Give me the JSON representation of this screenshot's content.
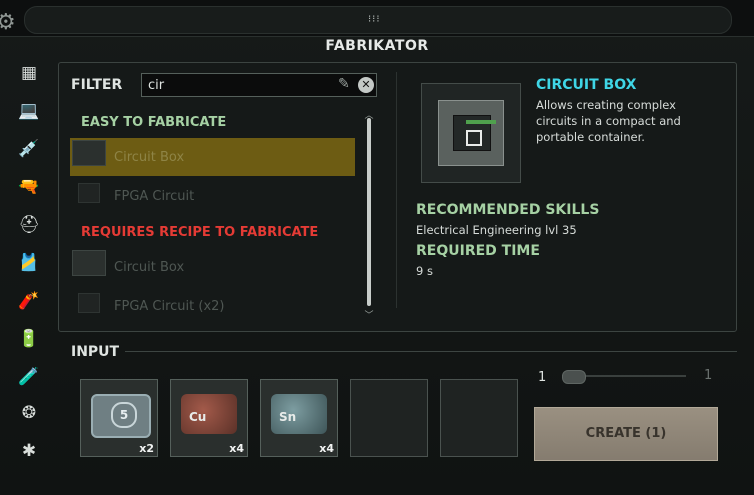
{
  "window": {
    "title": "FABRIKATOR"
  },
  "sidebar": {
    "items": [
      {
        "name": "all-categories-icon",
        "glyph": "▦"
      },
      {
        "name": "electronics-icon",
        "glyph": "💻"
      },
      {
        "name": "medical-icon",
        "glyph": "💉"
      },
      {
        "name": "weapons-icon",
        "glyph": "🔫"
      },
      {
        "name": "diving-gear-icon",
        "glyph": "⛑"
      },
      {
        "name": "equipment-icon",
        "glyph": "🎽"
      },
      {
        "name": "ammo-icon",
        "glyph": "🧨"
      },
      {
        "name": "power-icon",
        "glyph": "🔋"
      },
      {
        "name": "materials-icon",
        "glyph": "🧪"
      },
      {
        "name": "misc-icon",
        "glyph": "❂"
      },
      {
        "name": "other-icon",
        "glyph": "✱"
      }
    ]
  },
  "filter": {
    "label": "FILTER",
    "value": "cir"
  },
  "sections": {
    "easy": {
      "title": "EASY TO FABRICATE",
      "items": [
        {
          "label": "Circuit Box",
          "selected": true
        },
        {
          "label": "FPGA Circuit",
          "selected": false
        }
      ]
    },
    "recipe": {
      "title": "REQUIRES RECIPE TO FABRICATE",
      "items": [
        {
          "label": "Circuit Box",
          "selected": false
        },
        {
          "label": "FPGA Circuit (x2)",
          "selected": false
        }
      ]
    }
  },
  "details": {
    "name": "CIRCUIT BOX",
    "description": "Allows creating complex circuits in a compact and portable container.",
    "skills_heading": "RECOMMENDED SKILLS",
    "skills_value": "Electrical Engineering lvl 35",
    "time_heading": "REQUIRED TIME",
    "time_value": "9 s"
  },
  "input": {
    "label": "INPUT",
    "slots": [
      {
        "symbol": "5",
        "qty": "x2",
        "kind": "plastic"
      },
      {
        "symbol": "Cu",
        "qty": "x4",
        "kind": "copper"
      },
      {
        "symbol": "Sn",
        "qty": "x4",
        "kind": "tin"
      },
      {
        "symbol": "",
        "qty": "",
        "kind": "empty"
      },
      {
        "symbol": "",
        "qty": "",
        "kind": "empty"
      }
    ]
  },
  "stepper": {
    "value": "1",
    "max": "1"
  },
  "create_button": "CREATE (1)",
  "colors": {
    "accent_green": "#a6d1a4",
    "accent_red": "#e53b35",
    "accent_cyan": "#3fd6e6",
    "selected_row": "#6d5c13"
  }
}
